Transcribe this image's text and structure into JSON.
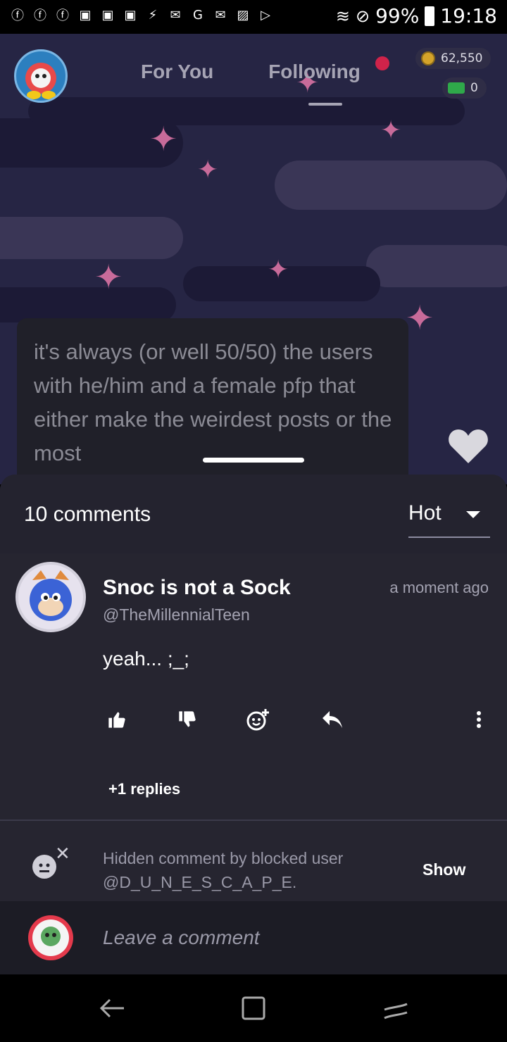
{
  "status_bar": {
    "icons": [
      "facebook-icon",
      "facebook-icon",
      "facebook-icon",
      "photo-icon",
      "photo-icon",
      "photo-icon",
      "bolt-icon",
      "gmail-icon",
      "google-icon",
      "gmail-icon",
      "image-icon",
      "play-store-icon"
    ],
    "battery": "99%",
    "time": "19:18"
  },
  "header": {
    "tabs": [
      "For You",
      "Following"
    ],
    "coins": "62,550",
    "cash": "0"
  },
  "post": {
    "text": "it's always (or well 50/50) the users with he/him and a female pfp that either make the weirdest posts or the most"
  },
  "comments": {
    "count_label": "10 comments",
    "sort_label": "Hot",
    "items": [
      {
        "name": "Snoc is not a Sock",
        "handle": "@TheMillennialTeen",
        "time": "a moment ago",
        "body": "yeah... ;_;",
        "replies": "+1 replies"
      }
    ],
    "blocked_text": "Hidden comment by blocked user @D_U_N_E_S_C_A_P_E.",
    "show_label": "Show",
    "composer_placeholder": "Leave a comment"
  },
  "colors": {
    "accent_red": "#d0234a",
    "sheet_bg": "#262530"
  }
}
